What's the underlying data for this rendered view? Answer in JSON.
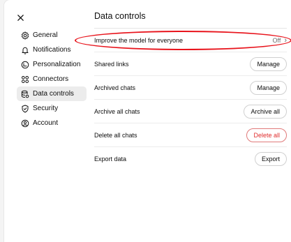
{
  "dialog": {
    "title": "Data controls"
  },
  "sidebar": {
    "items": [
      {
        "label": "General",
        "icon": "gear-icon"
      },
      {
        "label": "Notifications",
        "icon": "bell-icon"
      },
      {
        "label": "Personalization",
        "icon": "personalization-icon"
      },
      {
        "label": "Connectors",
        "icon": "connectors-icon"
      },
      {
        "label": "Data controls",
        "icon": "database-icon",
        "active": true
      },
      {
        "label": "Security",
        "icon": "security-icon"
      },
      {
        "label": "Account",
        "icon": "account-icon"
      }
    ]
  },
  "settings": {
    "improve_model": {
      "label": "Improve the model for everyone",
      "value": "Off"
    },
    "shared_links": {
      "label": "Shared links",
      "button": "Manage"
    },
    "archived_chats": {
      "label": "Archived chats",
      "button": "Manage"
    },
    "archive_all": {
      "label": "Archive all chats",
      "button": "Archive all"
    },
    "delete_all": {
      "label": "Delete all chats",
      "button": "Delete all"
    },
    "export": {
      "label": "Export data",
      "button": "Export"
    }
  },
  "colors": {
    "annotation": "#e8141c",
    "danger": "#e02e2e",
    "active_bg": "#ececec"
  }
}
